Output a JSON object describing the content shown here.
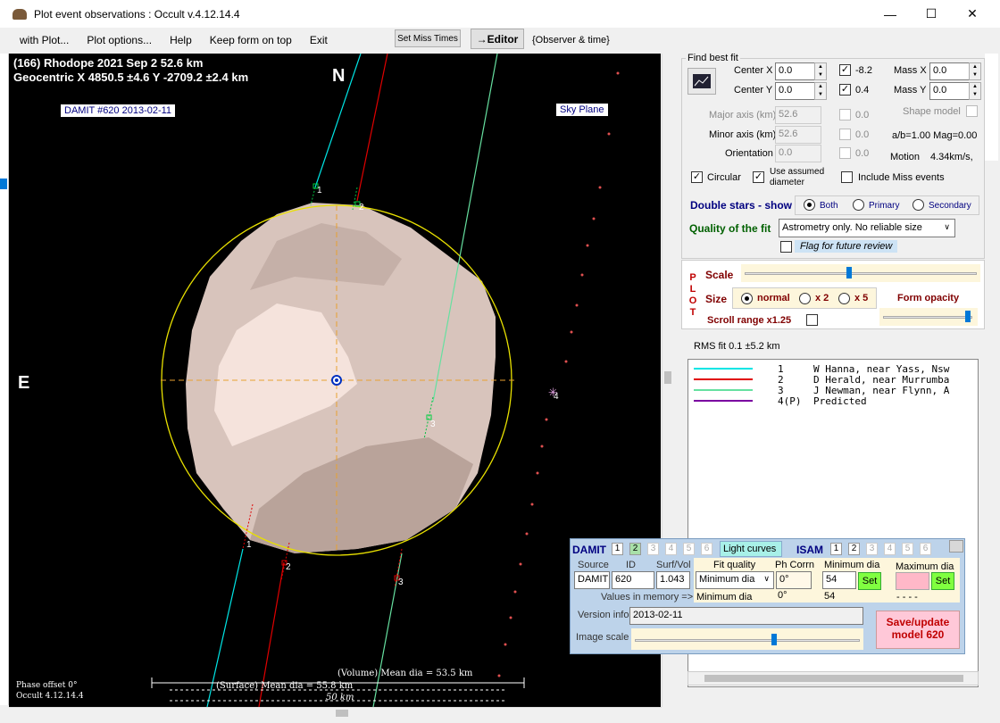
{
  "window": {
    "title": "Plot event observations : Occult v.4.12.14.4",
    "minimize": "—",
    "maximize": "☐",
    "close": "✕"
  },
  "menu": {
    "items": [
      "with Plot...",
      "Plot options...",
      "Help",
      "Keep form on top",
      "Exit"
    ],
    "set_miss_times": "Set Miss Times",
    "editor": "→Editor",
    "observer_time": "{Observer & time}"
  },
  "plot": {
    "title_line1": "(166) Rhodope  2021 Sep 2  52.6 km",
    "title_line2": "Geocentric  X  4850.5 ±4.6  Y -2709.2 ±2.4 km",
    "north": "N",
    "east": "E",
    "damit_label": "DAMIT #620 2013-02-11",
    "sky_plane": "Sky Plane",
    "phase_offset": "Phase offset 0°",
    "version": "Occult 4.12.14.4",
    "volume_dia": "(Volume) Mean dia = 53.5 km",
    "surface_dia": "(Surface) Mean dia = 55.8 km",
    "scale_label": "50 km",
    "chord_labels": [
      "1",
      "2",
      "3",
      "1",
      "2",
      "3",
      "4"
    ]
  },
  "best_fit": {
    "legend": "Find best fit",
    "center_x_label": "Center X",
    "center_x": "0.0",
    "center_y_label": "Center Y",
    "center_y": "0.0",
    "val1": "-8.2",
    "val2": "0.4",
    "mass_x_label": "Mass X",
    "mass_x": "0.0",
    "mass_y_label": "Mass Y",
    "mass_y": "0.0",
    "major_label": "Major axis (km)",
    "major": "52.6",
    "major_chk": "0.0",
    "minor_label": "Minor axis (km)",
    "minor": "52.6",
    "minor_chk": "0.0",
    "orient_label": "Orientation",
    "orient": "0.0",
    "orient_chk": "0.0",
    "shape_model": "Shape model",
    "ab_mag": "a/b=1.00  Mag=0.00",
    "motion_label": "Motion",
    "motion": "4.34km/s,",
    "circular": "Circular",
    "use_assumed": "Use assumed diameter",
    "include_miss": "Include Miss events",
    "double_stars": "Double stars - show",
    "both": "Both",
    "primary": "Primary",
    "secondary": "Secondary",
    "quality_label": "Quality of the fit",
    "quality_value": "Astrometry only. No reliable size",
    "flag_review": "Flag for future review"
  },
  "plot_panel": {
    "side_letters": [
      "P",
      "L",
      "O",
      "T"
    ],
    "scale": "Scale",
    "size": "Size",
    "normal": "normal",
    "x2": "x 2",
    "x5": "x 5",
    "form_opacity": "Form opacity",
    "scroll_range": "Scroll range x1.25",
    "scale_slider": 0.45,
    "opacity_slider": 0.98
  },
  "rms": "RMS fit 0.1 ±5.2 km",
  "legend_rows": [
    {
      "color": "#00e5e5",
      "num": "1",
      "text": "W Hanna, near Yass, Nsw"
    },
    {
      "color": "#e00000",
      "num": "2",
      "text": "D Herald, near Murrumba"
    },
    {
      "color": "#66e0a0",
      "num": "3",
      "text": "J Newman, near Flynn, A"
    },
    {
      "color": "#7a00a0",
      "num": "4(P)",
      "text": "Predicted"
    }
  ],
  "damit_panel": {
    "damit": "DAMIT",
    "tabs_damit": [
      "1",
      "2",
      "3",
      "4",
      "5",
      "6"
    ],
    "light_curves": "Light curves",
    "isam": "ISAM",
    "tabs_isam": [
      "1",
      "2",
      "3",
      "4",
      "5",
      "6"
    ],
    "source_label": "Source",
    "id_label": "ID",
    "surf_vol_label": "Surf/Vol",
    "source": "DAMIT",
    "id": "620",
    "surf_vol": "1.043",
    "values_mem": "Values in memory =>",
    "fit_quality": "Fit quality",
    "ph_corr": "Ph Corrn",
    "min_dia": "Minimum dia",
    "max_dia": "Maximum dia",
    "fit_select": "Minimum dia",
    "ph_value": "0°",
    "min_value": "54",
    "set": "Set",
    "mem_fit": "Minimum dia",
    "mem_ph": "0°",
    "mem_min": "54",
    "mem_max": "- - - -",
    "version_info_label": "Version info",
    "version_info": "2013-02-11",
    "image_scale": "Image scale",
    "save_update": "Save/update model 620",
    "image_scale_slider": 0.62
  }
}
